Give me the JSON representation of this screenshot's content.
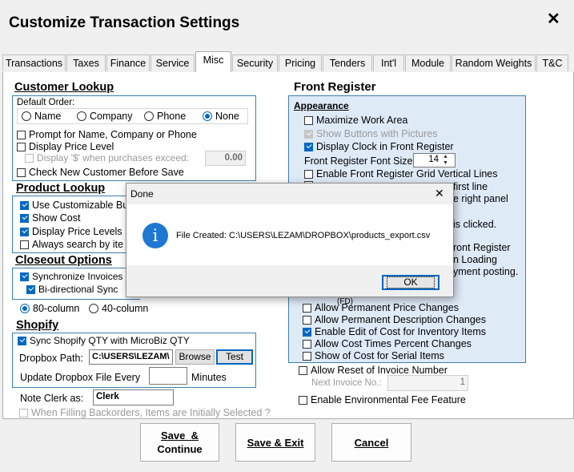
{
  "window": {
    "title": "Customize Transaction Settings",
    "close_glyph": "✕"
  },
  "tabs": [
    "Transactions",
    "Taxes",
    "Finance",
    "Service",
    "Misc",
    "Security",
    "Pricing",
    "Tenders",
    "Int'l",
    "Module",
    "Random Weights",
    "T&C"
  ],
  "active_tab": "Misc",
  "customer_lookup": {
    "title": "Customer Lookup",
    "default_order_label": "Default Order:",
    "options": [
      "Name",
      "Company",
      "Phone",
      "None"
    ],
    "selected": "None",
    "prompt": "Prompt for Name, Company or Phone",
    "display_price_level": "Display Price Level",
    "display_dollar": "Display '$' when purchases exceed:",
    "dollar_value": "0.00",
    "check_new": "Check New Customer Before Save"
  },
  "product_lookup": {
    "title": "Product Lookup",
    "items": [
      "Use Customizable Bu",
      "Show Cost",
      "Display Price Levels",
      "Always search by ite"
    ]
  },
  "closeout": {
    "title": "Closeout Options",
    "sync": "Synchronize Invoices B",
    "bidir": "Bi-directional Sync",
    "col80": "80-column",
    "col40": "40-column"
  },
  "shopify": {
    "title": "Shopify",
    "sync_qty": "Sync Shopify QTY with MicroBiz QTY",
    "dropbox_label": "Dropbox Path:",
    "dropbox_value": "C:\\USERS\\LEZAM\\",
    "browse": "Browse",
    "test": "Test",
    "update_label": "Update Dropbox File Every",
    "update_value": "",
    "minutes": "Minutes"
  },
  "note_clerk": {
    "label": "Note Clerk as:",
    "value": "Clerk"
  },
  "backorder": "When Filling Backorders, Items are Initially Selected ?",
  "front_register": {
    "title": "Front Register",
    "appearance": "Appearance",
    "maximize": "Maximize Work Area",
    "show_buttons": "Show Buttons with Pictures",
    "display_clock": "Display Clock in Front Register",
    "font_size_label": "Front Register Font Size",
    "font_size_value": "14",
    "grid_lines": "Enable Front Register Grid Vertical Lines",
    "first_line": "first line",
    "right_panel": "e right panel",
    "is_clicked": "is clicked.",
    "ront_register": "ront Register",
    "n_loading": "n Loading",
    "yment_posting": "yment posting.",
    "fd": "(FD)",
    "perm_price": "Allow Permanent Price Changes",
    "perm_desc": "Allow Permanent Description Changes",
    "edit_cost": "Enable Edit of Cost for Inventory Items",
    "cost_times": "Allow Cost Times Percent Changes",
    "show_cost_serial": "Show of Cost for Serial Items"
  },
  "invoice": {
    "reset": "Allow Reset of Invoice Number",
    "next_label": "Next Invoice No.:",
    "next_value": "1",
    "env_fee": "Enable Environmental Fee Feature"
  },
  "buttons": {
    "save_continue_1": "Save  &",
    "save_continue_2": "Continue",
    "save_exit": "Save & Exit",
    "cancel": "Cancel"
  },
  "dialog": {
    "title": "Done",
    "close_glyph": "✕",
    "message": "File Created: C:\\USERS\\LEZAM\\DROPBOX\\products_export.csv",
    "ok": "OK",
    "icon": "info-icon",
    "icon_color": "#1e78d2"
  }
}
